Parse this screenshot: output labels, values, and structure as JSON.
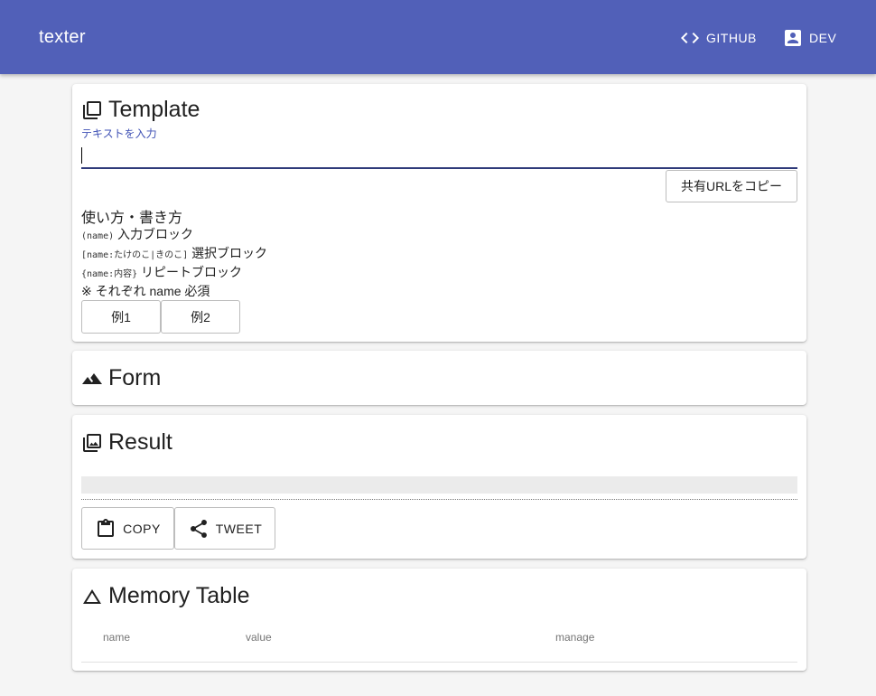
{
  "app": {
    "title": "texter",
    "nav": [
      {
        "label": "GITHUB",
        "icon": "code-icon"
      },
      {
        "label": "DEV",
        "icon": "account-box-icon"
      }
    ],
    "accent": "#5160b8"
  },
  "template": {
    "title": "Template",
    "input_label": "テキストを入力",
    "input_value": "",
    "copy_url_label": "共有URLをコピー",
    "howto_title": "使い方・書き方",
    "rules": [
      {
        "code": "(name)",
        "text": "入力ブロック"
      },
      {
        "code": "[name:たけのこ|きのこ]",
        "text": "選択ブロック"
      },
      {
        "code": "{name:内容}",
        "text": "リピートブロック"
      }
    ],
    "note": "※ それぞれ name 必須",
    "examples": [
      "例1",
      "例2"
    ]
  },
  "form": {
    "title": "Form"
  },
  "result": {
    "title": "Result",
    "copy_label": "COPY",
    "tweet_label": "TWEET"
  },
  "memory": {
    "title": "Memory Table",
    "columns": [
      "name",
      "value",
      "manage"
    ]
  }
}
